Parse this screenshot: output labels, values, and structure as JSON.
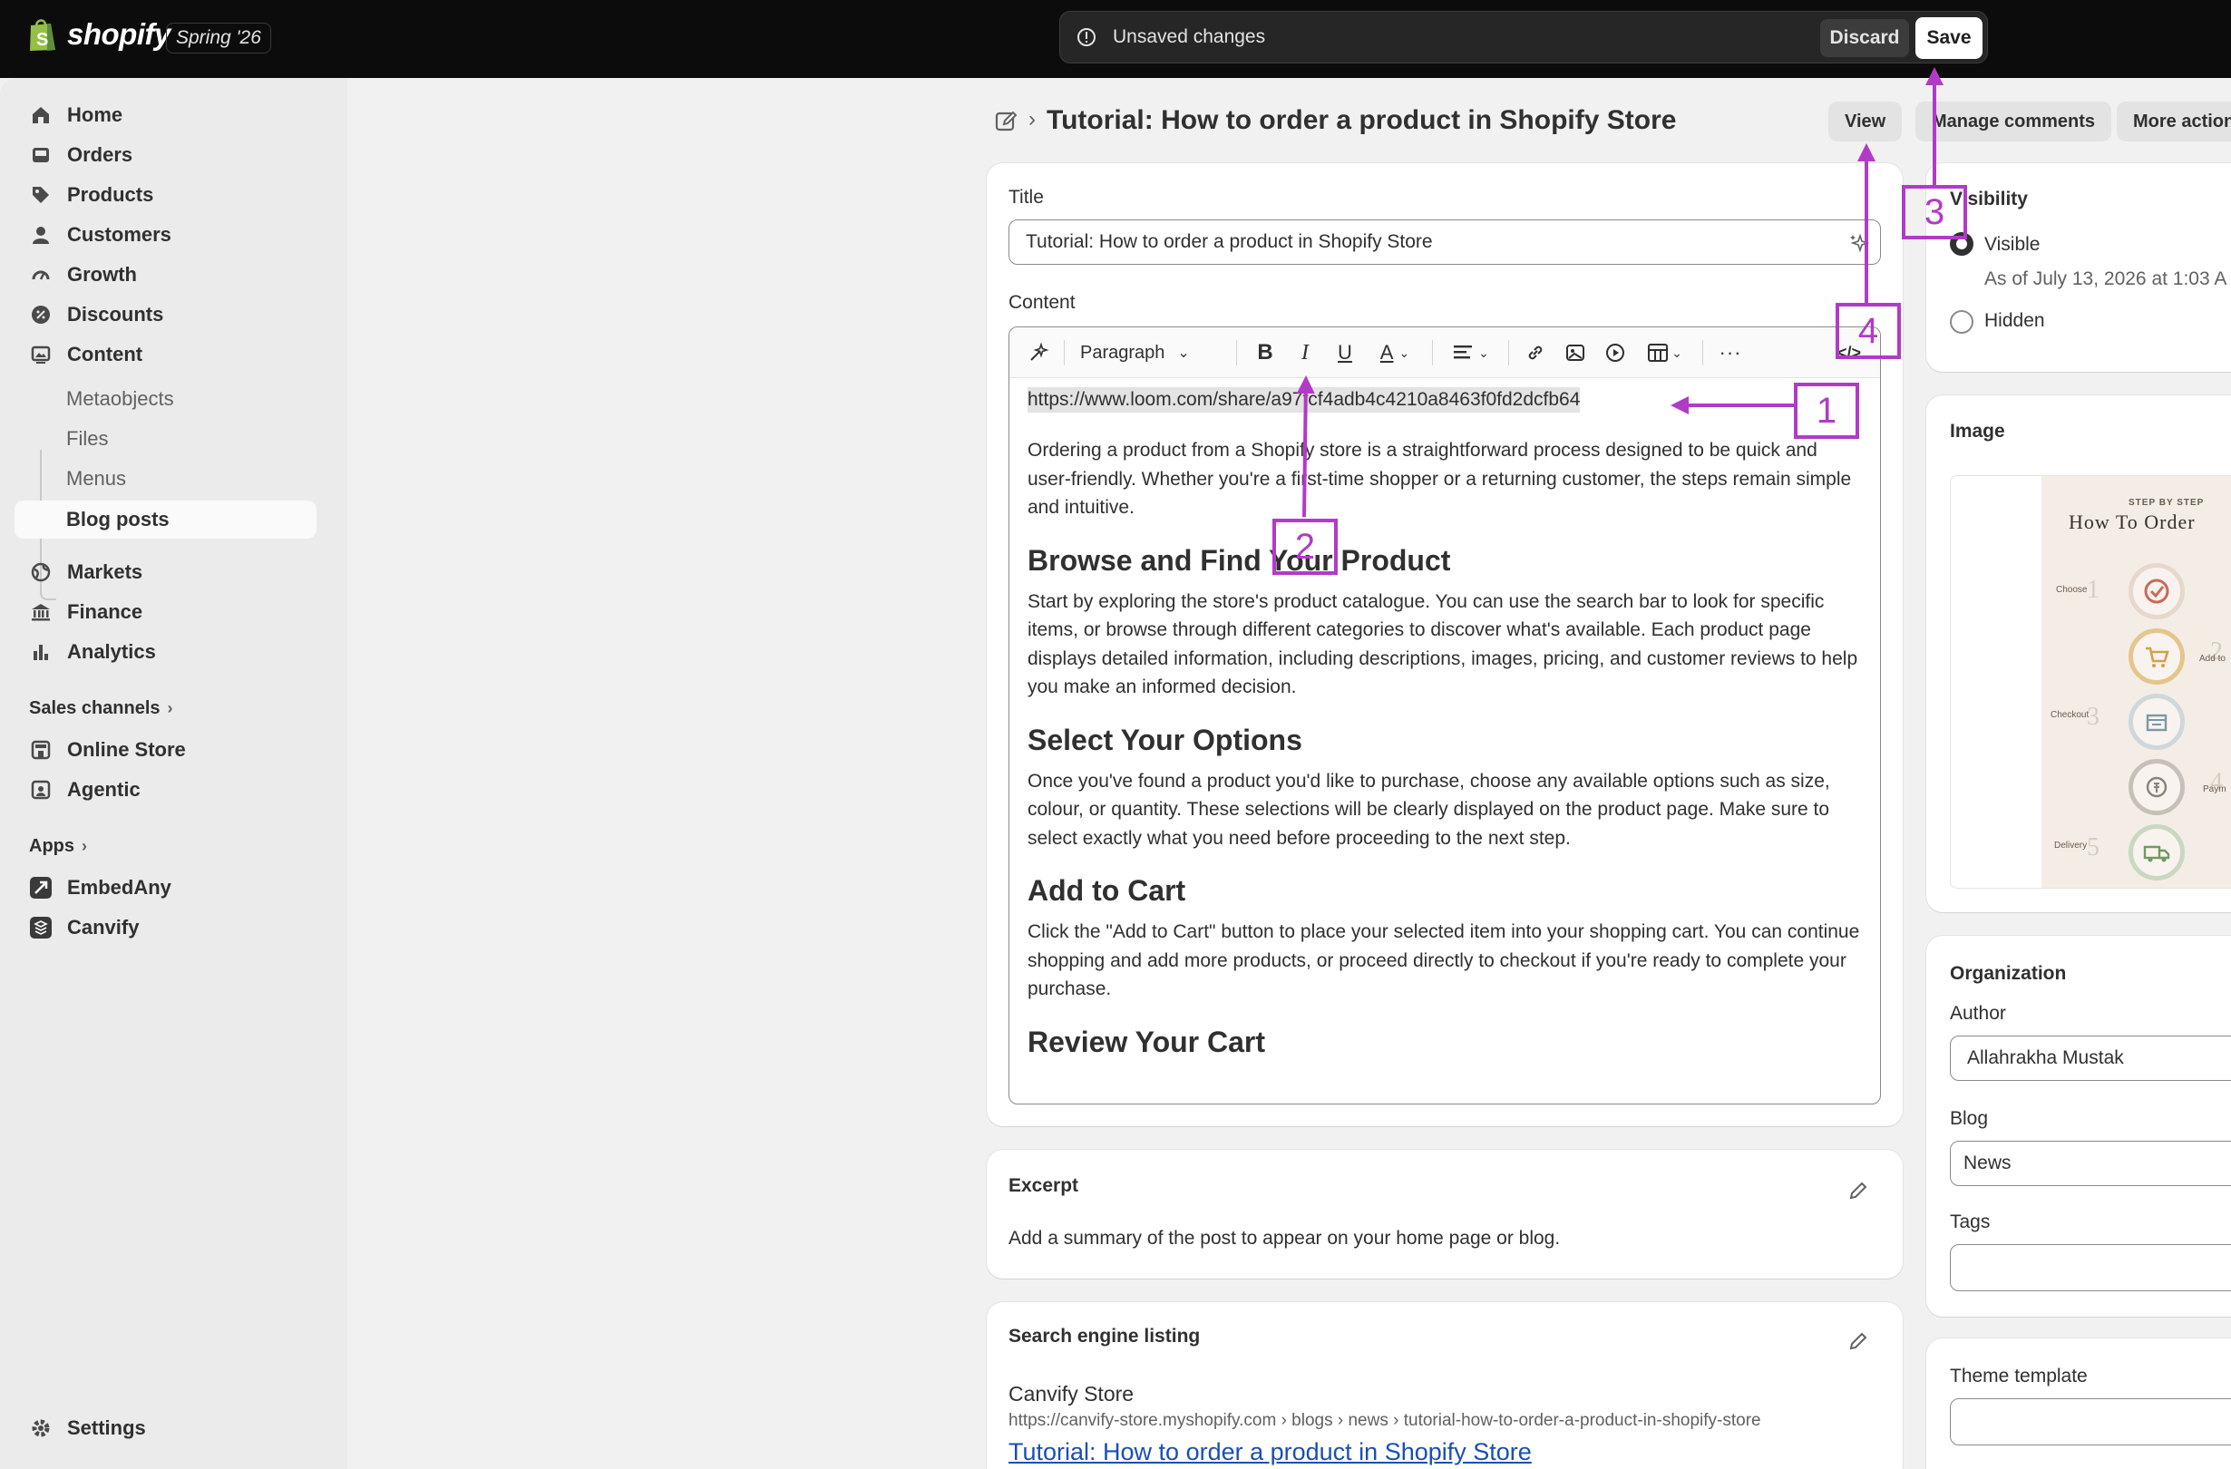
{
  "topbar": {
    "brand": "shopify",
    "edition": "Spring '26",
    "unsaved_text": "Unsaved changes",
    "discard_label": "Discard",
    "save_label": "Save"
  },
  "sidebar": {
    "items": [
      {
        "label": "Home",
        "icon": "home-icon"
      },
      {
        "label": "Orders",
        "icon": "inbox-icon"
      },
      {
        "label": "Products",
        "icon": "tag-icon"
      },
      {
        "label": "Customers",
        "icon": "person-icon"
      },
      {
        "label": "Growth",
        "icon": "gauge-icon"
      },
      {
        "label": "Discounts",
        "icon": "discount-badge-icon"
      },
      {
        "label": "Content",
        "icon": "image-frame-icon"
      }
    ],
    "content_sub": [
      "Metaobjects",
      "Files",
      "Menus",
      "Blog posts"
    ],
    "items2": [
      {
        "label": "Markets",
        "icon": "globe-icon"
      },
      {
        "label": "Finance",
        "icon": "bank-icon"
      },
      {
        "label": "Analytics",
        "icon": "bar-chart-icon"
      }
    ],
    "sales_channels_label": "Sales channels",
    "channels": [
      {
        "label": "Online Store",
        "icon": "store-icon"
      },
      {
        "label": "Agentic",
        "icon": "agentic-icon"
      }
    ],
    "apps_label": "Apps",
    "apps": [
      {
        "label": "EmbedAny",
        "icon": "embedany-icon"
      },
      {
        "label": "Canvify",
        "icon": "canvify-icon"
      }
    ],
    "settings_label": "Settings"
  },
  "header": {
    "title": "Tutorial: How to order a product in Shopify Store",
    "view_label": "View",
    "manage_comments_label": "Manage comments",
    "more_actions_label": "More actions"
  },
  "post": {
    "title_label": "Title",
    "title_value": "Tutorial: How to order a product in Shopify Store",
    "content_label": "Content",
    "toolbar": {
      "paragraph_label": "Paragraph"
    },
    "content": {
      "url": "https://www.loom.com/share/a97fcf4adb4c4210a8463f0fd2dcfb64",
      "intro": "Ordering a product from a Shopify store is a straightforward process designed to be quick and user-friendly. Whether you're a first-time shopper or a returning customer, the steps remain simple and intuitive.",
      "h1": "Browse and Find Your Product",
      "p1": "Start by exploring the store's product catalogue. You can use the search bar to look for specific items, or browse through different categories to discover what's available. Each product page displays detailed information, including descriptions, images, pricing, and customer reviews to help you make an informed decision.",
      "h2": "Select Your Options",
      "p2": "Once you've found a product you'd like to purchase, choose any available options such as size, colour, or quantity. These selections will be clearly displayed on the product page. Make sure to select exactly what you need before proceeding to the next step.",
      "h3": "Add to Cart",
      "p3": "Click the \"Add to Cart\" button to place your selected item into your shopping cart. You can continue shopping and add more products, or proceed directly to checkout if you're ready to complete your purchase.",
      "h4": "Review Your Cart"
    }
  },
  "excerpt": {
    "title": "Excerpt",
    "text": "Add a summary of the post to appear on your home page or blog."
  },
  "seo": {
    "title": "Search engine listing",
    "store": "Canvify Store",
    "url": "https://canvify-store.myshopify.com › blogs › news › tutorial-how-to-order-a-product-in-shopify-store",
    "link_title": "Tutorial: How to order a product in Shopify Store"
  },
  "visibility": {
    "title": "Visibility",
    "visible_label": "Visible",
    "visible_note": "As of July 13, 2026 at 1:03 A",
    "hidden_label": "Hidden",
    "selected": "Visible"
  },
  "image": {
    "title": "Image",
    "thumb_caption_small": "STEP BY STEP",
    "thumb_caption": "How To Order",
    "steps": [
      {
        "num": "1",
        "label": "Choose"
      },
      {
        "num": "2",
        "label": "Add to"
      },
      {
        "num": "3",
        "label": "Checkout"
      },
      {
        "num": "4",
        "label": "Paym"
      },
      {
        "num": "5",
        "label": "Delivery"
      }
    ]
  },
  "organization": {
    "title": "Organization",
    "author_label": "Author",
    "author_value": "Allahrakha Mustak",
    "blog_label": "Blog",
    "blog_value": "News",
    "tags_label": "Tags",
    "tags_value": ""
  },
  "theme": {
    "title": "Theme template",
    "value": ""
  },
  "annotations": [
    "1",
    "2",
    "3",
    "4"
  ],
  "colors": {
    "annotation": "#b13bc7",
    "topbar": "#0c0c0c",
    "link": "#1a4fb4"
  }
}
